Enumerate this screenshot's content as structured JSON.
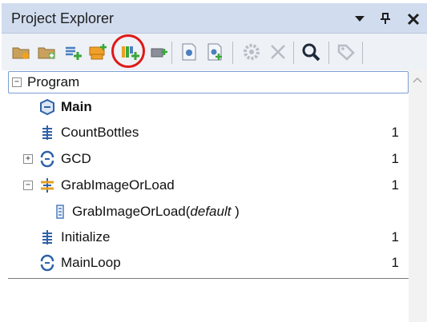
{
  "panel": {
    "title": "Project Explorer",
    "dropdown_icon": "triangle-down-icon",
    "pin_icon": "pin-icon",
    "close_icon": "close-icon"
  },
  "toolbar": {
    "icons": [
      "new-folder-icon",
      "add-folder-icon",
      "add-list-icon",
      "new-procedure-icon",
      "add-procedure-icon",
      "add-plugin-icon",
      "open-file-icon",
      "add-file-icon",
      "settings-icon",
      "delete-icon",
      "search-icon",
      "tag-icon"
    ],
    "highlight_color": "#e01818"
  },
  "tree": {
    "root": {
      "label": "Program",
      "expander": "−"
    },
    "items": [
      {
        "label": "Main",
        "count": "",
        "icon": "main-procedure-icon",
        "bold": true
      },
      {
        "label": "CountBottles",
        "count": "1",
        "icon": "procedure-icon"
      },
      {
        "label": "GCD",
        "count": "1",
        "icon": "loop-procedure-icon",
        "expander": "+"
      },
      {
        "label": "GrabImageOrLoad",
        "count": "1",
        "icon": "branch-procedure-icon",
        "expander": "−"
      },
      {
        "label": "GrabImageOrLoad(",
        "label_italic": "default",
        "label_end": " )",
        "count": "",
        "icon": "variant-icon"
      },
      {
        "label": "Initialize",
        "count": "1",
        "icon": "procedure-icon"
      },
      {
        "label": "MainLoop",
        "count": "1",
        "icon": "loop-procedure-icon"
      }
    ]
  },
  "colors": {
    "title_bg": "#d1ddef",
    "toolbar_bg": "#eef1f6",
    "selection_border": "#7a9fd0"
  }
}
